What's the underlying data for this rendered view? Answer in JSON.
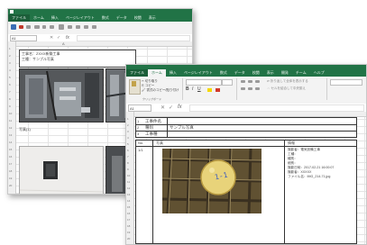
{
  "back_window": {
    "tabs": [
      "ファイル",
      "ホーム",
      "挿入",
      "ページレイアウト",
      "数式",
      "データ",
      "校閲",
      "表示"
    ],
    "formula_symbol": "fx",
    "name_box": "A1",
    "col_header": "A",
    "row_numbers": [
      "1",
      "2",
      "3",
      "4",
      "5",
      "6",
      "7",
      "8",
      "9",
      "10",
      "11",
      "12",
      "13",
      "14",
      "15",
      "16",
      "17",
      "18",
      "19",
      "20",
      "21",
      "22"
    ],
    "section_label": "写真(1)",
    "info_line_1": "工事名：ZXXX新築工事",
    "info_line_2": "工種：サンプル写真"
  },
  "front_window": {
    "tabs": [
      "ファイル",
      "ホーム",
      "挿入",
      "ページレイアウト",
      "数式",
      "データ",
      "校閲",
      "表示",
      "開発",
      "チーム",
      "ヘルプ"
    ],
    "clipboard": {
      "cut": "切り取り",
      "copy": "コピー",
      "format_painter": "書式のコピー/貼り付け",
      "group": "クリップボード"
    },
    "wrap_text": "折り返して全体を表示する",
    "merge": "セルを結合して中央揃え",
    "formula_symbol": "fx",
    "name_box": "A1",
    "header_rows": [
      {
        "num": "1",
        "label": "工事件名",
        "value": ""
      },
      {
        "num": "2",
        "label": "種別",
        "value": "サンプル写真"
      },
      {
        "num": "3",
        "label": "工事種",
        "value": ""
      }
    ],
    "row_numbers": [
      "1",
      "2",
      "3",
      "4",
      "5",
      "6",
      "7",
      "8",
      "9",
      "10",
      "11",
      "12",
      "13",
      "14",
      "15",
      "16",
      "17",
      "18",
      "19",
      "20",
      "21",
      "22",
      "23",
      "24"
    ],
    "table_headers": {
      "no": "No.",
      "photo": "写真",
      "info": "情報"
    },
    "photo_no": "1/1",
    "tag_label": "1-1",
    "photo_info": [
      "撮影者：電気設備工事",
      "工種：",
      "種別：",
      "細別：",
      "撮影日時：2017-02-21 16:00:07",
      "撮影者：XXXXX",
      "ファイル名：IMG_214-71.jpg"
    ]
  }
}
